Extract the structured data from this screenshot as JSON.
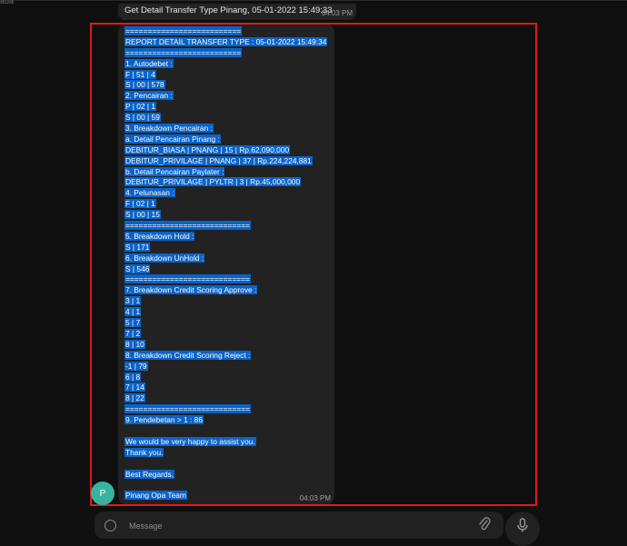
{
  "colors": {
    "background": "#0f0f0f",
    "bubble": "#222222",
    "selection": "#0b63c9",
    "highlight_border": "#e01a1a",
    "avatar": "#37b49f"
  },
  "corner_label": "aua",
  "previous_message": {
    "text": "Get Detail Transfer Type Pinang, 05-01-2022 15:49:33",
    "time": "04:03 PM"
  },
  "message": {
    "lines": [
      "==========================",
      "REPORT DETAIL TRANSFER TYPE : 05-01-2022 15:49:34",
      "==========================",
      "1. Autodebet :",
      "F | 51 | 4",
      "S | 00 | 578",
      "2. Pencairan :",
      "P | 02 | 1",
      "S | 00 | 59",
      "3. Breakdown Pencairan :",
      "a. Detail Pencairan Pinang  :",
      "DEBITUR_BIASA | PNANG | 15 | Rp.62,090,000",
      "DEBITUR_PRIVILAGE | PNANG | 37 | Rp.224,224,881",
      "b. Detail Pencairan Paylater :",
      "DEBITUR_PRIVILAGE | PYLTR | 3 | Rp.45,000,000",
      "4. Pelunasan :",
      "F | 02 | 1",
      "S | 00 | 15",
      "============================",
      "5. Breakdown Hold   :",
      "S | 171",
      "6. Breakdown UnHold   :",
      "S | 546",
      "============================",
      "7. Breakdown Credit Scoring Approve   :",
      "3 | 1",
      "4 | 1",
      "5 | 7",
      "7 | 2",
      "8 | 10",
      "8. Breakdown Credit Scoring Reject   :",
      "-1 | 79",
      "6 | 8",
      "7 | 14",
      "8 | 22",
      "============================",
      "9. Pendebetan > 1   : 86",
      "",
      "We would be very happy to assist you.",
      "Thank you.",
      "",
      "Best Regards,",
      "",
      "Pinang Opa Team"
    ],
    "time": "04:03 PM"
  },
  "sender": {
    "avatar_initial": "P"
  },
  "composer": {
    "placeholder": "Message",
    "emoji_icon": "smiley-icon",
    "attach_icon": "paperclip-icon",
    "mic_icon": "microphone-icon"
  }
}
